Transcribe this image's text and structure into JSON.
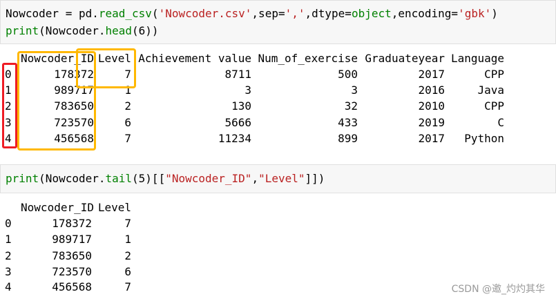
{
  "cell1": {
    "code": {
      "line1": {
        "var": "Nowcoder",
        "eq": " = pd.",
        "fn": "read_csv",
        "p1": "(",
        "s1": "'Nowcoder.csv'",
        "p2": ",sep=",
        "s2": "','",
        "p3": ",dtype=",
        "kw": "object",
        "p4": ",encoding=",
        "s3": "'gbk'",
        "p5": ")"
      },
      "line2": {
        "fn": "print",
        "p1": "(Nowcoder.",
        "fn2": "head",
        "p2": "(6))"
      }
    },
    "table": {
      "columns": [
        "Nowcoder_ID",
        "Level",
        "Achievement value",
        "Num_of_exercise",
        "Graduateyear",
        "Language"
      ],
      "rows": [
        {
          "index": "0",
          "cells": [
            "178372",
            "7",
            "8711",
            "500",
            "2017",
            "CPP"
          ]
        },
        {
          "index": "1",
          "cells": [
            "989717",
            "1",
            "3",
            "3",
            "2016",
            "Java"
          ]
        },
        {
          "index": "2",
          "cells": [
            "783650",
            "2",
            "130",
            "32",
            "2010",
            "CPP"
          ]
        },
        {
          "index": "3",
          "cells": [
            "723570",
            "6",
            "5666",
            "433",
            "2019",
            "C"
          ]
        },
        {
          "index": "4",
          "cells": [
            "456568",
            "7",
            "11234",
            "899",
            "2017",
            "Python"
          ]
        }
      ]
    }
  },
  "cell2": {
    "code": {
      "fn": "print",
      "p1": "(Nowcoder.",
      "fn2": "tail",
      "p2": "(5)[[",
      "s1": "\"Nowcoder_ID\"",
      "p3": ",",
      "s2": "\"Level\"",
      "p4": "]])"
    },
    "table": {
      "columns": [
        "Nowcoder_ID",
        "Level"
      ],
      "rows": [
        {
          "index": "0",
          "cells": [
            "178372",
            "7"
          ]
        },
        {
          "index": "1",
          "cells": [
            "989717",
            "1"
          ]
        },
        {
          "index": "2",
          "cells": [
            "783650",
            "2"
          ]
        },
        {
          "index": "3",
          "cells": [
            "723570",
            "6"
          ]
        },
        {
          "index": "4",
          "cells": [
            "456568",
            "7"
          ]
        }
      ]
    }
  },
  "watermark": "CSDN @邀_灼灼其华",
  "colors": {
    "highlight_orange": "#ffb800",
    "highlight_red": "#ee1c24",
    "code_green": "#008000",
    "string_red": "#ba2121"
  }
}
